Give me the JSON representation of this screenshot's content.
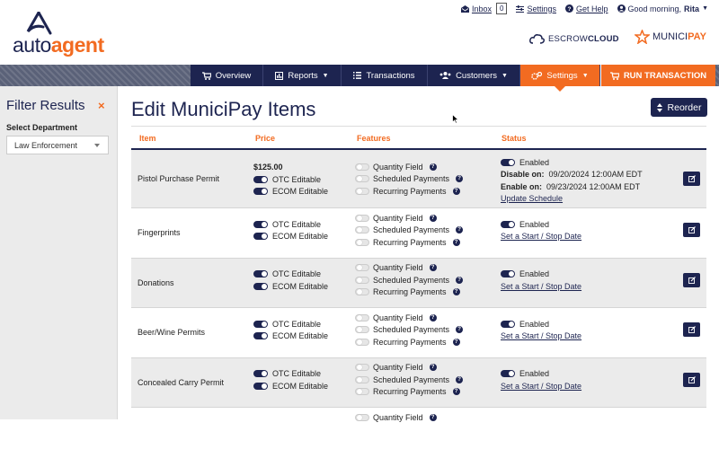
{
  "utility": {
    "inbox_label": "Inbox",
    "inbox_count": "0",
    "settings_label": "Settings",
    "help_label": "Get Help",
    "greeting": "Good morning,",
    "user_name": "Rita"
  },
  "logo": {
    "part1": "auto",
    "part2": "agent"
  },
  "partners": {
    "escrow_a": "ESCROW",
    "escrow_b": "CLOUD",
    "munici_a": "MUNICI",
    "munici_b": "PAY"
  },
  "nav": {
    "overview": "Overview",
    "reports": "Reports",
    "transactions": "Transactions",
    "customers": "Customers",
    "settings": "Settings",
    "run": "RUN TRANSACTION"
  },
  "sidebar": {
    "title": "Filter Results",
    "close": "×",
    "department_label": "Select Department",
    "department_value": "Law Enforcement"
  },
  "main": {
    "title": "Edit MuniciPay Items",
    "reorder": "Reorder",
    "columns": {
      "item": "Item",
      "price": "Price",
      "features": "Features",
      "status": "Status"
    }
  },
  "items": [
    {
      "name": "Pistol Purchase Permit",
      "price": "$125.00",
      "otc": "OTC Editable",
      "ecom": "ECOM Editable",
      "features": [
        "Quantity Field",
        "Scheduled Payments",
        "Recurring Payments"
      ],
      "status": "Enabled",
      "disable_label": "Disable on:",
      "disable_value": "09/20/2024 12:00AM EDT",
      "enable_label": "Enable on:",
      "enable_value": "09/23/2024 12:00AM EDT",
      "schedule_link": "Update Schedule"
    },
    {
      "name": "Fingerprints",
      "otc": "OTC Editable",
      "ecom": "ECOM Editable",
      "features": [
        "Quantity Field",
        "Scheduled Payments",
        "Recurring Payments"
      ],
      "status": "Enabled",
      "schedule_link": "Set a Start / Stop Date"
    },
    {
      "name": "Donations",
      "otc": "OTC Editable",
      "ecom": "ECOM Editable",
      "features": [
        "Quantity Field",
        "Scheduled Payments",
        "Recurring Payments"
      ],
      "status": "Enabled",
      "schedule_link": "Set a Start / Stop Date"
    },
    {
      "name": "Beer/Wine Permits",
      "otc": "OTC Editable",
      "ecom": "ECOM Editable",
      "features": [
        "Quantity Field",
        "Scheduled Payments",
        "Recurring Payments"
      ],
      "status": "Enabled",
      "schedule_link": "Set a Start / Stop Date"
    },
    {
      "name": "Concealed Carry Permit",
      "otc": "OTC Editable",
      "ecom": "ECOM Editable",
      "features": [
        "Quantity Field",
        "Scheduled Payments",
        "Recurring Payments"
      ],
      "status": "Enabled",
      "schedule_link": "Set a Start / Stop Date"
    },
    {
      "features": [
        "Quantity Field"
      ]
    }
  ],
  "colors": {
    "navy": "#1d2450",
    "orange": "#f26b21"
  }
}
